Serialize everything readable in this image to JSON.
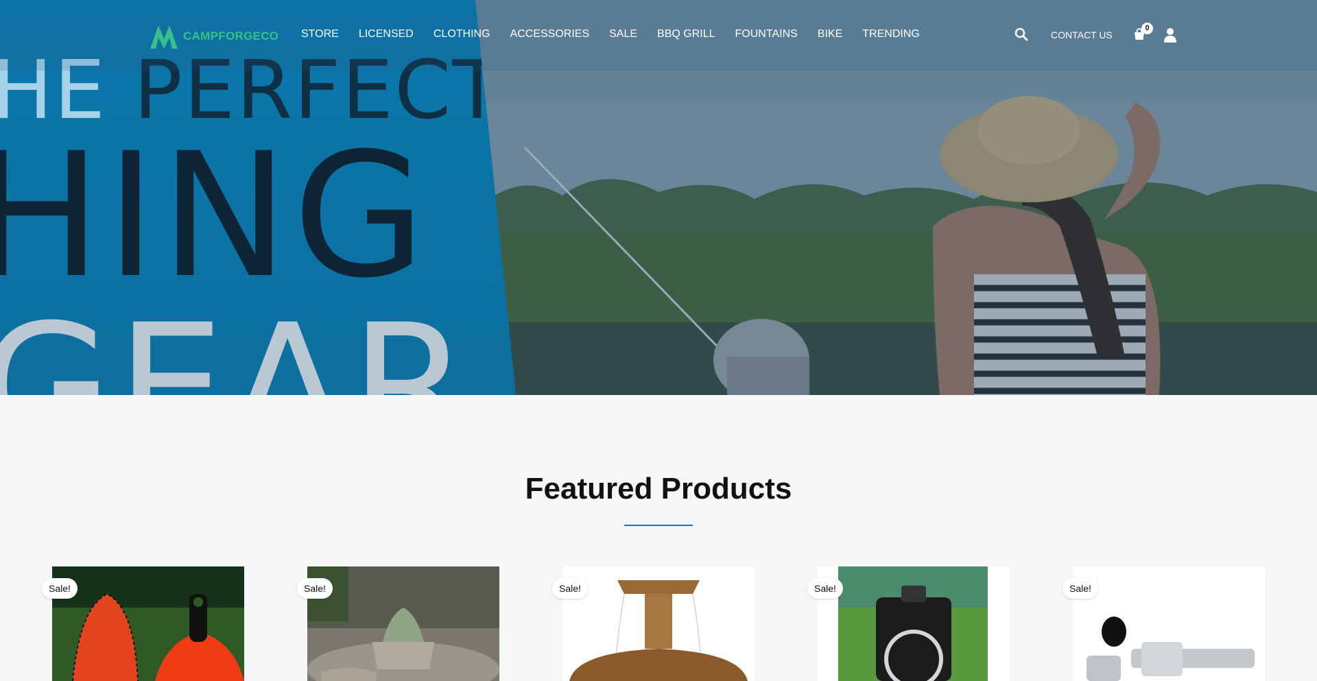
{
  "header": {
    "logo_text": "CAMPFORGECO",
    "nav": [
      "STORE",
      "LICENSED",
      "CLOTHING",
      "ACCESSORIES",
      "SALE",
      "BBQ GRILL",
      "FOUNTAINS",
      "BIKE",
      "TRENDING"
    ],
    "contact_label": "CONTACT US",
    "cart_count": "0",
    "icons": {
      "search": "search-icon",
      "cart": "cart-icon",
      "account": "user-icon"
    }
  },
  "hero": {
    "banner_line1_light": "HE",
    "banner_line1_dark": " PERFECT",
    "banner_line2": "HING",
    "banner_line3": "GEAR"
  },
  "featured": {
    "title": "Featured Products",
    "badge": "Sale!"
  },
  "colors": {
    "accent": "#1a73b0",
    "logo_green": "#37c08a",
    "banner_blue": "#0a78ac"
  }
}
